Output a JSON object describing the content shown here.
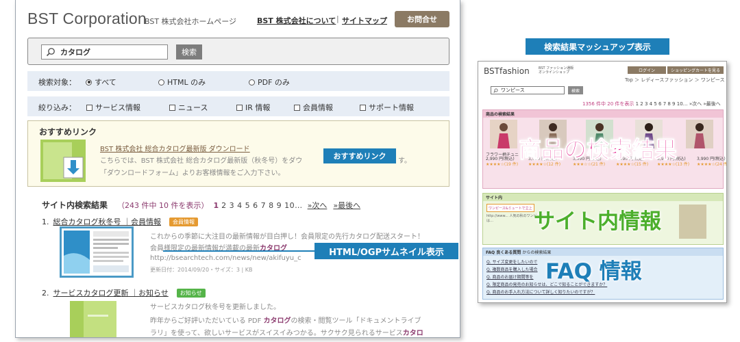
{
  "left": {
    "site_title": "BST Corporation",
    "site_subtitle": "BST 株式会社ホームページ",
    "nav": {
      "about": "BST 株式会社について",
      "separator": "|",
      "sitemap": "サイトマップ",
      "contact": "お問合せ"
    },
    "search": {
      "value": "カタログ",
      "button": "検索",
      "icon": "search-icon"
    },
    "target": {
      "label": "検索対象：",
      "options": [
        {
          "label": "すべて",
          "checked": true
        },
        {
          "label": "HTML のみ",
          "checked": false
        },
        {
          "label": "PDF のみ",
          "checked": false
        }
      ]
    },
    "narrow": {
      "label": "絞り込み：",
      "options": [
        "サービス情報",
        "ニュース",
        "IR 情報",
        "会員情報",
        "サポート情報"
      ]
    },
    "recommend": {
      "title": "おすすめリンク",
      "link": "BST 株式会社 総合カタログ最新版 ダウンロード",
      "desc1": "こちらでは、BST 株式会社 総合カタログ最新版（秋冬号）をダウ",
      "desc1_tail": "す。",
      "desc2": "「ダウンロードフォーム」よりお客様情報をご入力下さい。"
    },
    "results": {
      "heading": "サイト内検索結果",
      "count": "（243 件中 10 件を表示）",
      "current_page": "1",
      "pages": "2 3 4 5 6 7 8 9 10…",
      "next": "»次へ",
      "last": "»最後へ"
    },
    "result1": {
      "num": "1.",
      "title": "総合カタログ秋冬号 ｜会員情報",
      "badge": "会員情報",
      "line1": "これからの季節に大注目の最新情報が目白押し！会員限定の先行カタログ配送スタート！",
      "line2_pre": "会員様限定の最新情報が満載の最新",
      "line2_hl": "カタログ",
      "url": "http://bsearchtech.com/news/new/akifuyu_c",
      "meta": "更新日付：2014/09/20・サイズ：3 | KB"
    },
    "result2": {
      "num": "2.",
      "title": "サービスカタログ更新 ｜お知らせ",
      "badge": "お知らせ",
      "line1": "サービスカタログ秋冬号を更新しました。",
      "line2_pre": "昨年からご好評いただいている PDF ",
      "line2_hl": "カタログ",
      "line2_post": "の検索・閲覧ツール「ドキュメントライブ",
      "line3_pre": "ラリ」を使って、欲しいサービスがスイスイみつかる。サクサク見られるサービス",
      "line3_hl": "カタロ"
    },
    "overlays": {
      "recommend": "おすすめリンク",
      "thumbnail": "HTML/OGPサムネイル表示"
    }
  },
  "right": {
    "title": "検索結果マッシュアップ表示",
    "logo": "BSTfashion",
    "logo_sub1": "BST ファッション通販",
    "logo_sub2": "オンラインショップ",
    "login": "ログイン",
    "cart": "ショッピングカートを見る",
    "breadcrumb": "Top ＞ レディースファッション ＞ ワンピース",
    "search_value": "ワンピース",
    "search_button": "検索",
    "count_pre": "1356 件中 20 件を表示",
    "count_pages": " 1 2 3 4 5 6 7 8 9 10… »次へ »最後へ",
    "products": {
      "heading": "商品の検索結果",
      "items": [
        {
          "price": "2,990 円(税込)",
          "stars": "★★★★☆(19 件)"
        },
        {
          "price": "3,990 円(税込)",
          "stars": "★★★★☆(12 件)"
        },
        {
          "price": "3,990 円(税込)",
          "stars": "★★★☆☆(21 件)"
        },
        {
          "price": "3,990 円(税込)",
          "stars": "★★★★☆(15 件)"
        },
        {
          "price": "3,990 円(税込)",
          "stars": "★★★★☆(13 件)"
        },
        {
          "price": "3,990 円(税込)",
          "stars": "★★★★☆(24 件)"
        }
      ],
      "big_label": "商品の検索結果",
      "item1_name": "フラワー柄チュニ"
    },
    "site": {
      "heading": "サイト内",
      "heading_suffix": "情報",
      "banner": "ワンピース&ミュートで立上",
      "text": "http://www... 人気の秋のワンピースは…",
      "big_label": "サイト内情報"
    },
    "faq": {
      "heading": "FAQ 良くある質問",
      "heading_suffix": "からの検索結果",
      "items": [
        "Q. サイズ変更をしたいので",
        "Q. 複数商品を購入した場合",
        "Q. 商品のお届け期間等を",
        "Q. 限定商品の発売のお知らせは、どこで知ることができますか？",
        "Q. 商品のお手入れ方法について詳しく知りたいのですが？"
      ],
      "big_label": "FAQ 情報"
    }
  },
  "colors": {
    "accent_blue": "#1e7fb8",
    "brown": "#8b7a64",
    "magenta": "#8b3a6e",
    "pink": "#e3248c",
    "green": "#4caf2c"
  }
}
